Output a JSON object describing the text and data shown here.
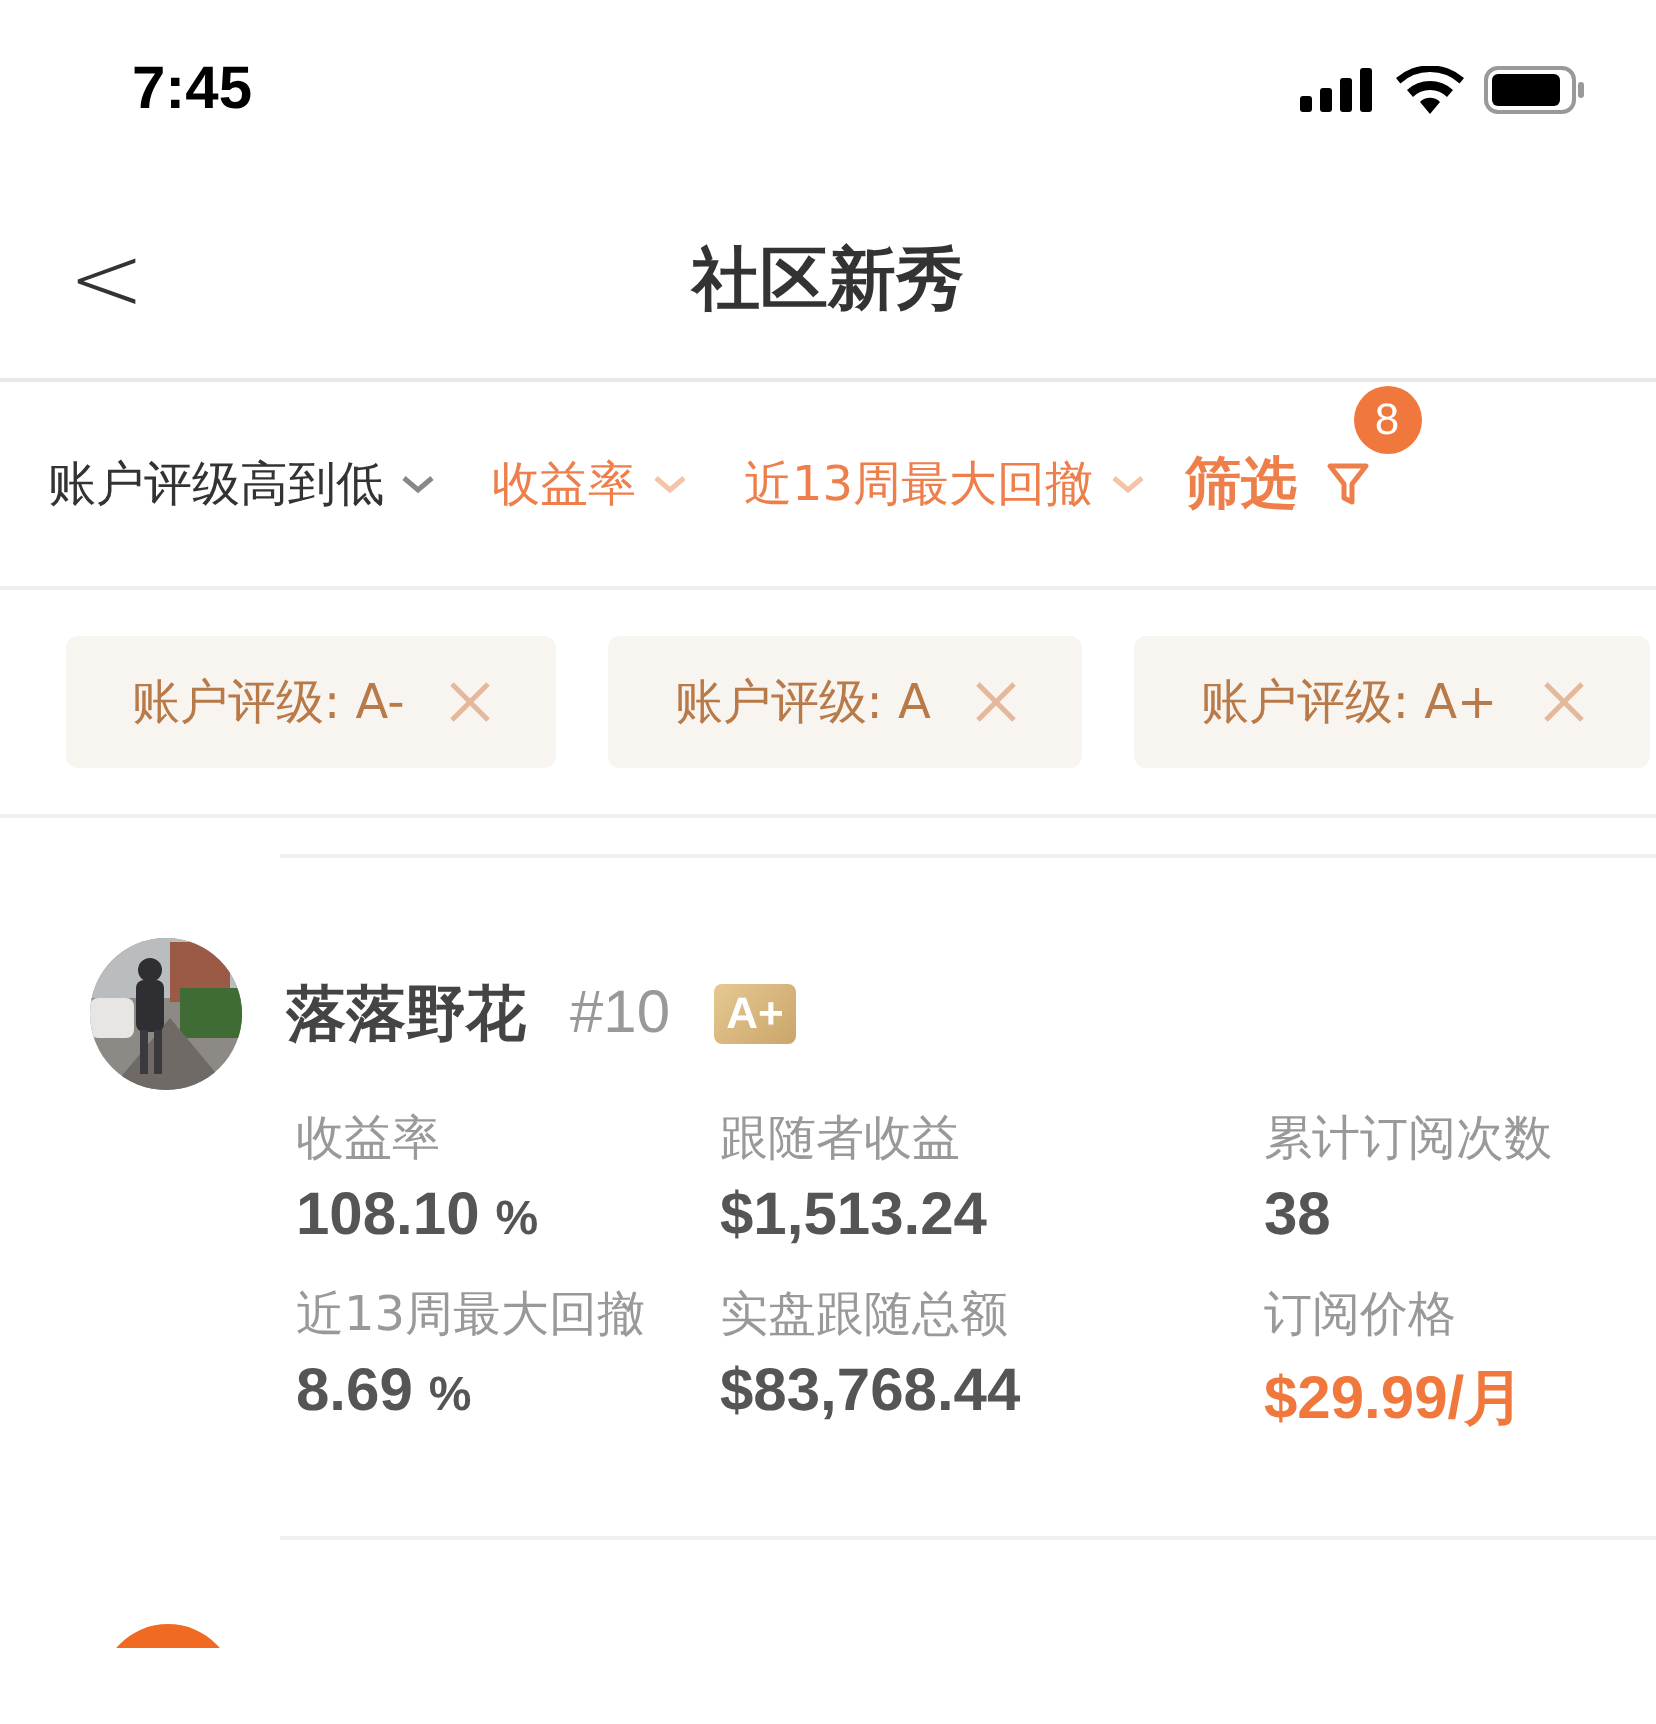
{
  "status_bar": {
    "time": "7:45"
  },
  "nav": {
    "back": "<",
    "title": "社区新秀"
  },
  "sort_bar": {
    "options": [
      {
        "label": "账户评级高到低",
        "active": false
      },
      {
        "label": "收益率",
        "active": true
      },
      {
        "label": "近13周最大回撤",
        "active": true
      }
    ],
    "filter": {
      "label": "筛选",
      "badge": "8"
    }
  },
  "chips": [
    {
      "label": "账户评级: A-"
    },
    {
      "label": "账户评级: A"
    },
    {
      "label": "账户评级: A+"
    }
  ],
  "traders": [
    {
      "name": "落落野花",
      "rank": "#10",
      "grade": "A+",
      "stats": [
        {
          "label": "收益率",
          "value": "108.10",
          "unit": "%",
          "kind": "plain"
        },
        {
          "label": "跟随者收益",
          "value": "$1,513.24",
          "kind": "plain"
        },
        {
          "label": "累计订阅次数",
          "value": "38",
          "kind": "plain"
        },
        {
          "label": "近13周最大回撤",
          "value": "8.69",
          "unit": "%",
          "kind": "plain"
        },
        {
          "label": "实盘跟随总额",
          "value": "$83,768.44",
          "kind": "plain"
        },
        {
          "label": "订阅价格",
          "value": "$29.99/月",
          "kind": "price"
        }
      ]
    }
  ]
}
